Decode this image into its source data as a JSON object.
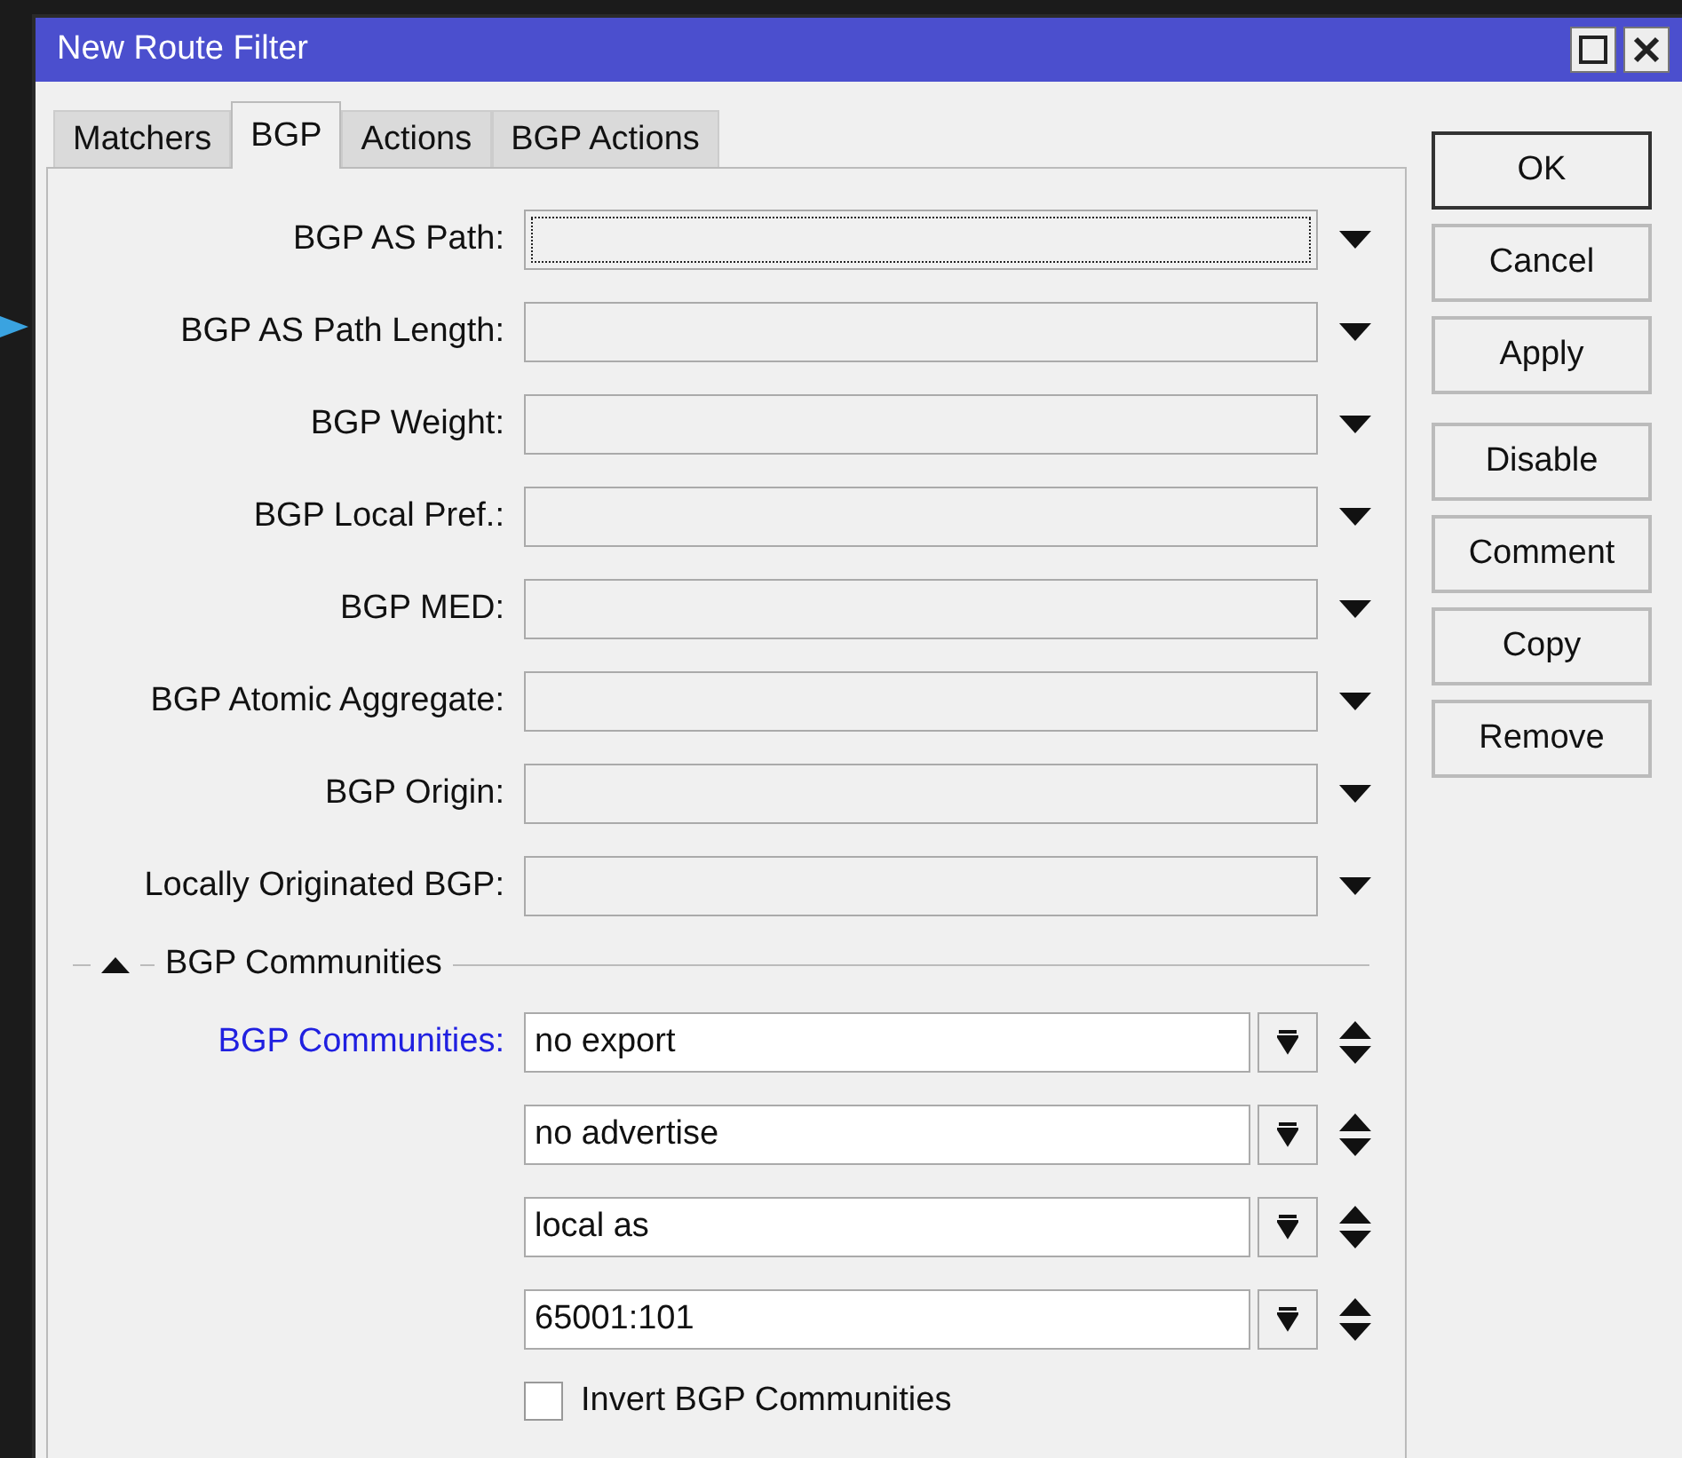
{
  "window": {
    "title": "New Route Filter"
  },
  "tabs": [
    {
      "label": "Matchers",
      "selected": false
    },
    {
      "label": "BGP",
      "selected": true
    },
    {
      "label": "Actions",
      "selected": false
    },
    {
      "label": "BGP Actions",
      "selected": false
    }
  ],
  "fields": [
    {
      "label": "BGP AS Path:",
      "focused": true
    },
    {
      "label": "BGP AS Path Length:",
      "focused": false
    },
    {
      "label": "BGP Weight:",
      "focused": false
    },
    {
      "label": "BGP Local Pref.:",
      "focused": false
    },
    {
      "label": "BGP MED:",
      "focused": false
    },
    {
      "label": "BGP Atomic Aggregate:",
      "focused": false
    },
    {
      "label": "BGP Origin:",
      "focused": false
    },
    {
      "label": "Locally Originated BGP:",
      "focused": false
    }
  ],
  "communities": {
    "title": "BGP Communities",
    "expanded": true,
    "label": "BGP Communities:",
    "values": [
      "no export",
      "no advertise",
      "local as",
      "65001:101"
    ],
    "invert": {
      "label": "Invert BGP Communities",
      "checked": false
    }
  },
  "buttons": [
    {
      "label": "OK",
      "default": true
    },
    {
      "label": "Cancel",
      "default": false
    },
    {
      "label": "Apply",
      "default": false
    },
    {
      "label": "Disable",
      "default": false,
      "gap": true
    },
    {
      "label": "Comment",
      "default": false
    },
    {
      "label": "Copy",
      "default": false
    },
    {
      "label": "Remove",
      "default": false
    }
  ]
}
